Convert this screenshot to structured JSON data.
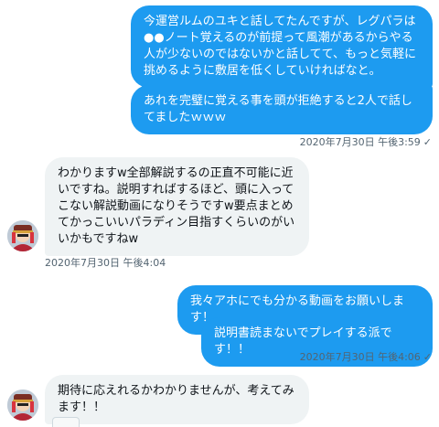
{
  "messages": [
    {
      "direction": "sent",
      "text": "今運営ルムのユキと話してたんですが、レグパラは●●ノート覚えるのが前提って風潮があるからやる人が少ないのではないかと話してて、もっと気軽に挑めるように敷居を低くしていければなと。"
    },
    {
      "direction": "sent",
      "text": "あれを完璧に覚える事を頭が拒絶すると2人で話してましたｗｗｗ"
    },
    {
      "direction": "received",
      "text": "わかりますw全部解説するの正直不可能に近いですね。説明すればするほど、頭に入ってこない解説動画になりそうですw要点まとめてかっこいいパラディン目指すくらいのがいいかもですねw"
    },
    {
      "direction": "sent",
      "text": "我々アホにでも分かる動画をお願いします！"
    },
    {
      "direction": "sent",
      "text": "説明書読まないでプレイする派です！！"
    },
    {
      "direction": "received",
      "text": "期待に応えれるかわかりませんが、考えてみます！！"
    }
  ],
  "timestamps": {
    "sent_group_1": "2020年7月30日 午後3:59",
    "received_group_1": "2020年7月30日 午後4:04",
    "sent_group_2": "2020年7月30日 午後4:06"
  },
  "read_mark": "✓",
  "colors": {
    "sent_bubble": "#1d9bf0",
    "received_bubble": "#eff3f4",
    "meta_text": "#536471"
  }
}
